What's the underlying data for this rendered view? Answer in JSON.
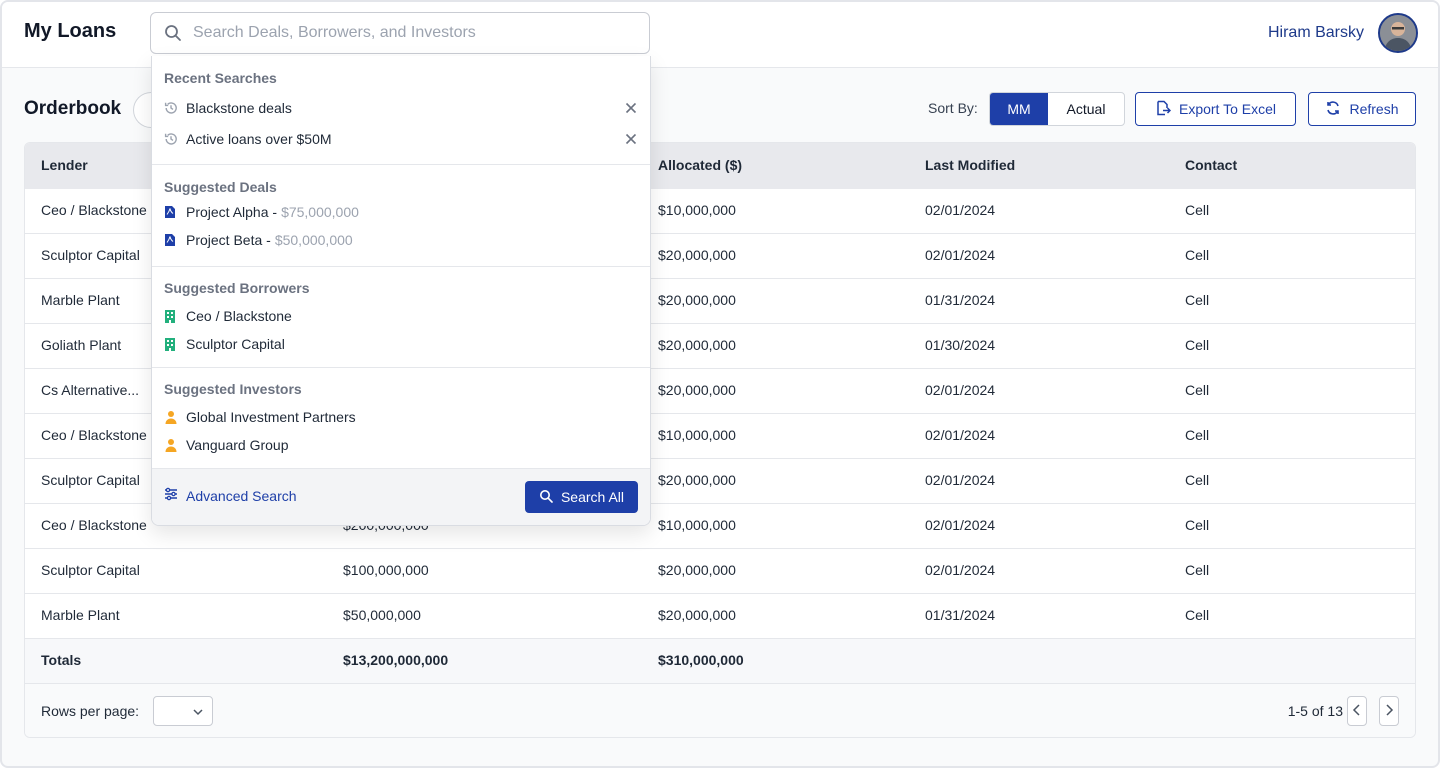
{
  "header": {
    "app_title": "My Loans",
    "search_placeholder": "Search Deals, Borrowers, and Investors",
    "user_name": "Hiram Barsky"
  },
  "toolbar": {
    "section_title": "Orderbook",
    "sort_label": "Sort By:",
    "sort_options": [
      "MM",
      "Actual"
    ],
    "sort_selected": "MM",
    "export_label": "Export To Excel",
    "refresh_label": "Refresh"
  },
  "table": {
    "columns": [
      "Lender",
      "",
      "Allocated ($)",
      "Last Modified",
      "Contact"
    ],
    "rows": [
      {
        "lender": "Ceo / Blackstone",
        "amount": "",
        "allocated": "$10,000,000",
        "modified": "02/01/2024",
        "contact": "Cell"
      },
      {
        "lender": "Sculptor Capital",
        "amount": "",
        "allocated": "$20,000,000",
        "modified": "02/01/2024",
        "contact": "Cell"
      },
      {
        "lender": "Marble Plant",
        "amount": "",
        "allocated": "$20,000,000",
        "modified": "01/31/2024",
        "contact": "Cell"
      },
      {
        "lender": "Goliath Plant",
        "amount": "",
        "allocated": "$20,000,000",
        "modified": "01/30/2024",
        "contact": "Cell"
      },
      {
        "lender": "Cs Alternative...",
        "amount": "",
        "allocated": "$20,000,000",
        "modified": "02/01/2024",
        "contact": "Cell"
      },
      {
        "lender": "Ceo / Blackstone",
        "amount": "",
        "allocated": "$10,000,000",
        "modified": "02/01/2024",
        "contact": "Cell"
      },
      {
        "lender": "Sculptor Capital",
        "amount": "",
        "allocated": "$20,000,000",
        "modified": "02/01/2024",
        "contact": "Cell"
      },
      {
        "lender": "Ceo / Blackstone",
        "amount": "$200,000,000",
        "allocated": "$10,000,000",
        "modified": "02/01/2024",
        "contact": "Cell"
      },
      {
        "lender": "Sculptor Capital",
        "amount": "$100,000,000",
        "allocated": "$20,000,000",
        "modified": "02/01/2024",
        "contact": "Cell"
      },
      {
        "lender": "Marble Plant",
        "amount": "$50,000,000",
        "allocated": "$20,000,000",
        "modified": "01/31/2024",
        "contact": "Cell"
      }
    ],
    "totals": {
      "label": "Totals",
      "amount": "$13,200,000,000",
      "allocated": "$310,000,000"
    }
  },
  "pagination": {
    "rows_per_page_label": "Rows per page:",
    "rows_per_page_value": "",
    "range_text": "1-5 of 13"
  },
  "search_dropdown": {
    "recent_title": "Recent Searches",
    "recent": [
      "Blackstone deals",
      "Active loans over $50M"
    ],
    "deals_title": "Suggested Deals",
    "deals": [
      {
        "name": "Project Alpha - ",
        "value": "$75,000,000"
      },
      {
        "name": "Project Beta - ",
        "value": "$50,000,000"
      }
    ],
    "borrowers_title": "Suggested Borrowers",
    "borrowers": [
      "Ceo / Blackstone",
      "Sculptor Capital"
    ],
    "investors_title": "Suggested Investors",
    "investors": [
      "Global Investment Partners",
      "Vanguard Group"
    ],
    "advanced_label": "Advanced Search",
    "search_all_label": "Search All"
  },
  "colors": {
    "primary": "#1e3fa8",
    "borrower_icon": "#22b07d",
    "investor_icon": "#f5a623"
  }
}
